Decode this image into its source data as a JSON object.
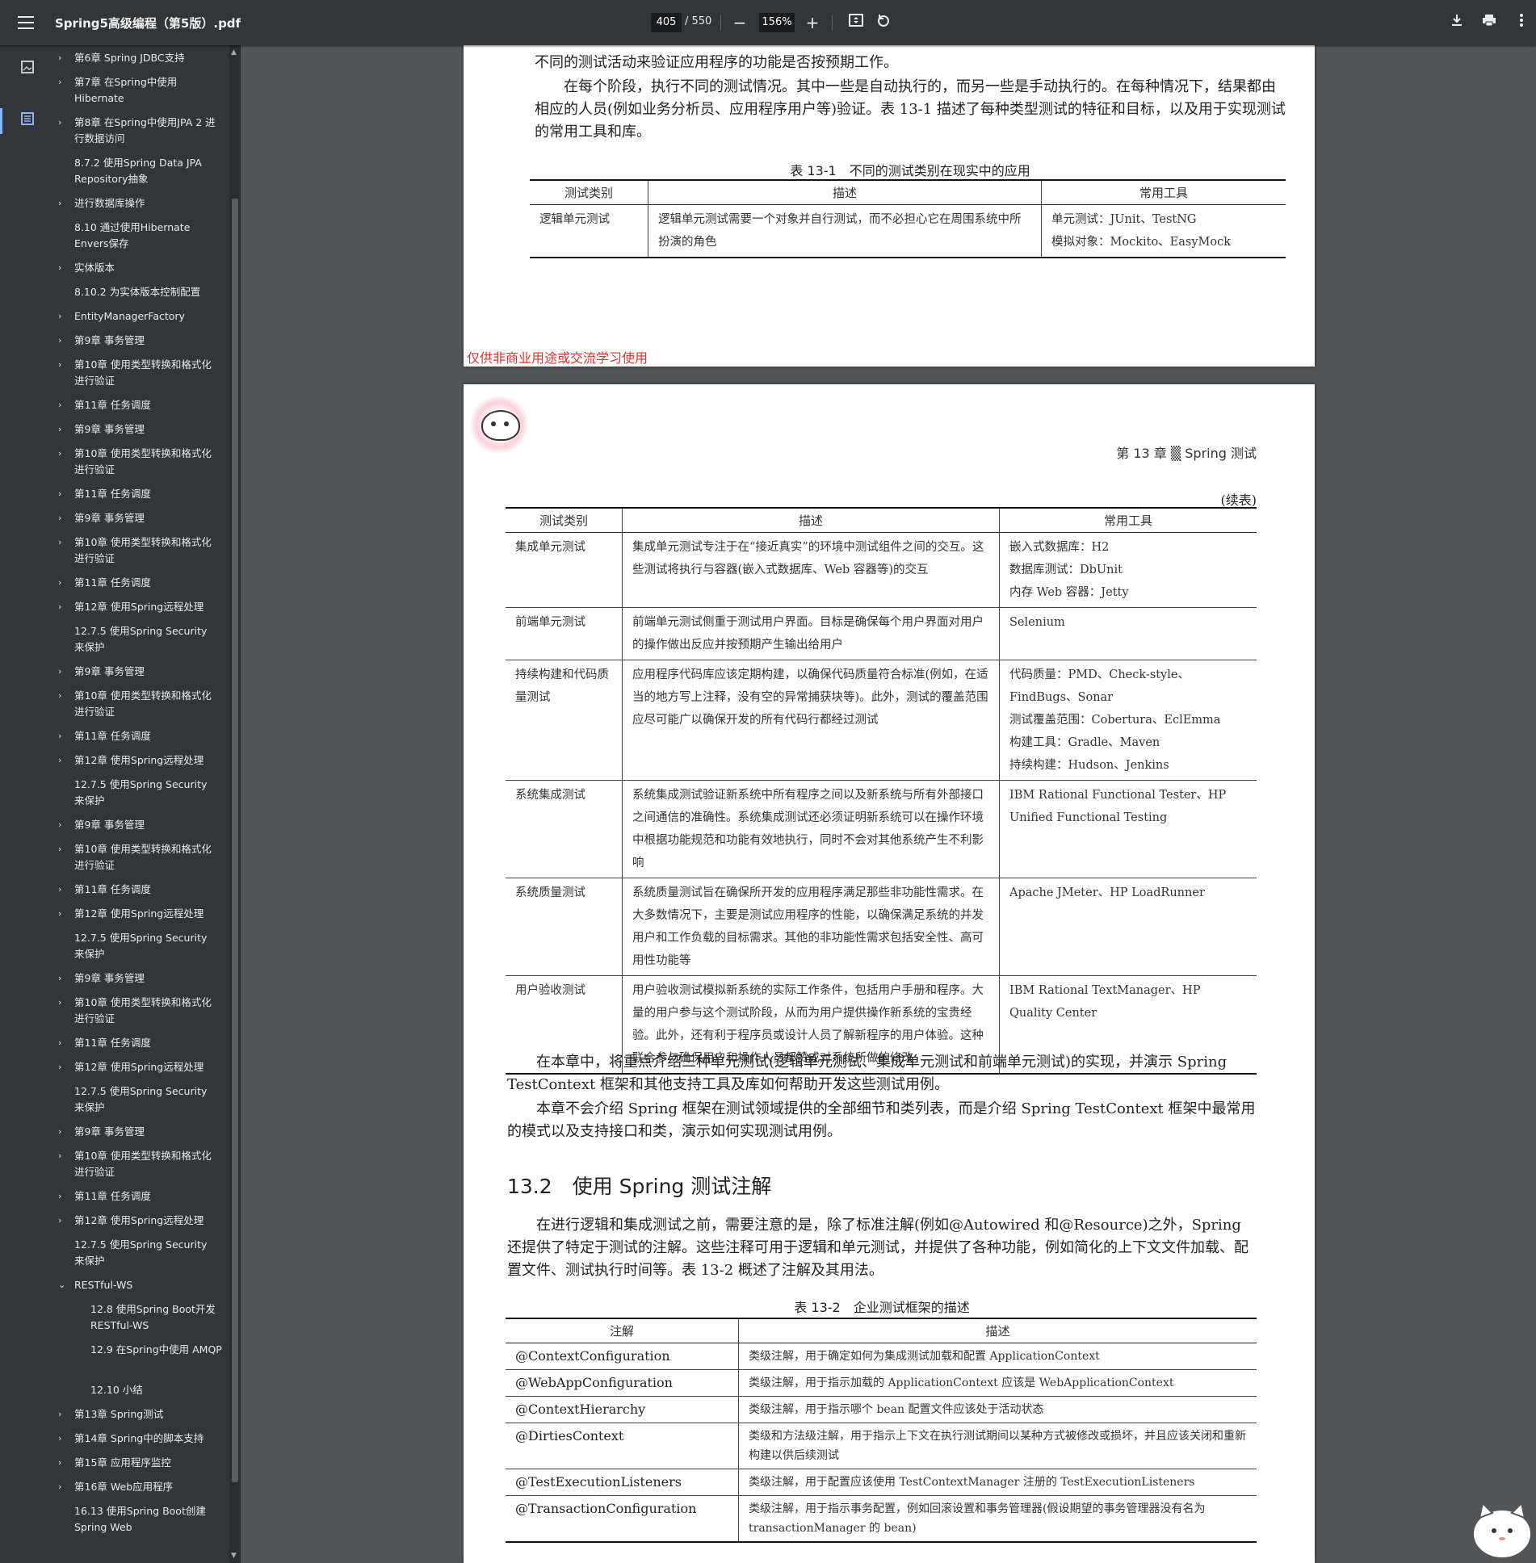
{
  "toolbar": {
    "title": "Spring5高级编程（第5版）.pdf",
    "page_current": "405",
    "page_total": "/ 550",
    "zoom": "156%",
    "zoom_out": "−",
    "zoom_in": "+"
  },
  "outline": [
    {
      "chev": "›",
      "label": "第6章 Spring JDBC支持"
    },
    {
      "chev": "›",
      "label": "第7章 在Spring中使用 Hibernate"
    },
    {
      "chev": "›",
      "label": "第8章 在Spring中使用JPA 2 进行数据访问"
    },
    {
      "chev": "",
      "label": "8.7.2 使用Spring Data JPA Repository抽象"
    },
    {
      "chev": "›",
      "label": "进行数据库操作"
    },
    {
      "chev": "",
      "label": "8.10 通过使用Hibernate Envers保存"
    },
    {
      "chev": "›",
      "label": "实体版本"
    },
    {
      "chev": "",
      "label": "8.10.2 为实体版本控制配置"
    },
    {
      "chev": "›",
      "label": "EntityManagerFactory"
    },
    {
      "chev": "›",
      "label": "第9章 事务管理"
    },
    {
      "chev": "›",
      "label": "第10章 使用类型转换和格式化进行验证"
    },
    {
      "chev": "›",
      "label": "第11章 任务调度"
    },
    {
      "chev": "›",
      "label": "第9章 事务管理"
    },
    {
      "chev": "›",
      "label": "第10章 使用类型转换和格式化进行验证"
    },
    {
      "chev": "›",
      "label": "第11章 任务调度"
    },
    {
      "chev": "›",
      "label": "第9章 事务管理"
    },
    {
      "chev": "›",
      "label": "第10章 使用类型转换和格式化进行验证"
    },
    {
      "chev": "›",
      "label": "第11章 任务调度"
    },
    {
      "chev": "›",
      "label": "第12章 使用Spring远程处理"
    },
    {
      "chev": "",
      "label": "12.7.5 使用Spring Security来保护"
    },
    {
      "chev": "›",
      "label": "第9章 事务管理"
    },
    {
      "chev": "›",
      "label": "第10章 使用类型转换和格式化进行验证"
    },
    {
      "chev": "›",
      "label": "第11章 任务调度"
    },
    {
      "chev": "›",
      "label": "第12章 使用Spring远程处理"
    },
    {
      "chev": "",
      "label": "12.7.5 使用Spring Security来保护"
    },
    {
      "chev": "›",
      "label": "第9章 事务管理"
    },
    {
      "chev": "›",
      "label": "第10章 使用类型转换和格式化进行验证"
    },
    {
      "chev": "›",
      "label": "第11章 任务调度"
    },
    {
      "chev": "›",
      "label": "第12章 使用Spring远程处理"
    },
    {
      "chev": "",
      "label": "12.7.5 使用Spring Security来保护"
    },
    {
      "chev": "›",
      "label": "第9章 事务管理"
    },
    {
      "chev": "›",
      "label": "第10章 使用类型转换和格式化进行验证"
    },
    {
      "chev": "›",
      "label": "第11章 任务调度"
    },
    {
      "chev": "›",
      "label": "第12章 使用Spring远程处理"
    },
    {
      "chev": "",
      "label": "12.7.5 使用Spring Security来保护"
    },
    {
      "chev": "›",
      "label": "第9章 事务管理"
    },
    {
      "chev": "›",
      "label": "第10章 使用类型转换和格式化进行验证"
    },
    {
      "chev": "›",
      "label": "第11章 任务调度"
    },
    {
      "chev": "›",
      "label": "第12章 使用Spring远程处理"
    },
    {
      "chev": "",
      "label": "12.7.5 使用Spring Security来保护"
    },
    {
      "chev": "⌄",
      "label": "RESTful-WS"
    },
    {
      "chev": "",
      "label": "12.8 使用Spring Boot开发 RESTful-WS"
    },
    {
      "chev": "",
      "label": "12.9 在Spring中使用 AMQP"
    },
    {
      "chev": "",
      "label": "12.10 小结"
    },
    {
      "chev": "›",
      "label": "第13章 Spring测试"
    },
    {
      "chev": "›",
      "label": "第14章 Spring中的脚本支持"
    },
    {
      "chev": "›",
      "label": "第15章 应用程序监控"
    },
    {
      "chev": "›",
      "label": "第16章 Web应用程序"
    },
    {
      "chev": "",
      "label": "16.13 使用Spring Boot创建 Spring Web"
    }
  ],
  "page1": {
    "top_line": "企业测试框架是指在整个应用程序生命周期中的测试活动。在不同的阶段，根据所定义的业务和技术要求，执行不同的测试活动来验证应用程序的功能是否按预期工作。",
    "top_line_visible": "不同的测试活动来验证应用程序的功能是否按预期工作。",
    "para": "在每个阶段，执行不同的测试情况。其中一些是自动执行的，而另一些是手动执行的。在每种情况下，结果都由相应的人员(例如业务分析员、应用程序用户等)验证。表 13-1 描述了每种类型测试的特征和目标，以及用于实现测试的常用工具和库。",
    "caption": "表 13-1　不同的测试类别在现实中的应用",
    "headers": [
      "测试类别",
      "描述",
      "常用工具"
    ],
    "rows": [
      [
        "逻辑单元测试",
        "逻辑单元测试需要一个对象并自行测试，而不必担心它在周围系统中所扮演的角色",
        "单元测试：JUnit、TestNG\n模拟对象：Mockito、EasyMock"
      ]
    ],
    "watermark": "仅供非商业用途或交流学习使用"
  },
  "page2": {
    "running_head": "第 13 章 ▒ Spring 测试",
    "continued": "(续表)",
    "headers": [
      "测试类别",
      "描述",
      "常用工具"
    ],
    "rows": [
      [
        "集成单元测试",
        "集成单元测试专注于在“接近真实”的环境中测试组件之间的交互。这些测试将执行与容器(嵌入式数据库、Web 容器等)的交互",
        "嵌入式数据库：H2\n数据库测试：DbUnit\n内存 Web 容器：Jetty"
      ],
      [
        "前端单元测试",
        "前端单元测试侧重于测试用户界面。目标是确保每个用户界面对用户的操作做出反应并按预期产生输出给用户",
        "Selenium"
      ],
      [
        "持续构建和代码质量测试",
        "应用程序代码库应该定期构建，以确保代码质量符合标准(例如，在适当的地方写上注释，没有空的异常捕获块等)。此外，测试的覆盖范围应尽可能广以确保开发的所有代码行都经过测试",
        "代码质量：PMD、Check-style、FindBugs、Sonar\n测试覆盖范围：Cobertura、EclEmma\n构建工具：Gradle、Maven\n持续构建：Hudson、Jenkins"
      ],
      [
        "系统集成测试",
        "系统集成测试验证新系统中所有程序之间以及新系统与所有外部接口之间通信的准确性。系统集成测试还必须证明新系统可以在操作环境中根据功能规范和功能有效地执行，同时不会对其他系统产生不利影响",
        "IBM Rational Functional Tester、HP Unified Functional Testing"
      ],
      [
        "系统质量测试",
        "系统质量测试旨在确保所开发的应用程序满足那些非功能性需求。在大多数情况下，主要是测试应用程序的性能，以确保满足系统的并发用户和工作负载的目标需求。其他的非功能性需求包括安全性、高可用性功能等",
        "Apache JMeter、HP LoadRunner"
      ],
      [
        "用户验收测试",
        "用户验收测试模拟新系统的实际工作条件，包括用户手册和程序。大量的用户参与这个测试阶段，从而为用户提供操作新系统的宝贵经验。此外，还有利于程序员或设计人员了解新程序的用户体验。这种联合参与确保用户和操作人员都赞成对系统所做的修改",
        "IBM Rational TextManager、HP Quality Center"
      ]
    ],
    "para1": "在本章中，将重点介绍三种单元测试(逻辑单元测试、集成单元测试和前端单元测试)的实现，并演示 Spring TestContext 框架和其他支持工具及库如何帮助开发这些测试用例。",
    "para2": "本章不会介绍 Spring 框架在测试领域提供的全部细节和类列表，而是介绍 Spring TestContext 框架中最常用的模式以及支持接口和类，演示如何实现测试用例。",
    "heading": "13.2　使用 Spring 测试注解",
    "para3": "在进行逻辑和集成测试之前，需要注意的是，除了标准注解(例如@Autowired 和@Resource)之外，Spring 还提供了特定于测试的注解。这些注释可用于逻辑和单元测试，并提供了各种功能，例如简化的上下文文件加载、配置文件、测试执行时间等。表 13-2 概述了注解及其用法。",
    "caption2": "表 13-2　企业测试框架的描述",
    "headers2": [
      "注解",
      "描述"
    ],
    "rows2": [
      [
        "@ContextConfiguration",
        "类级注解，用于确定如何为集成测试加载和配置 ApplicationContext"
      ],
      [
        "@WebAppConfiguration",
        "类级注解，用于指示加载的 ApplicationContext 应该是 WebApplicationContext"
      ],
      [
        "@ContextHierarchy",
        "类级注解，用于指示哪个 bean 配置文件应该处于活动状态"
      ],
      [
        "@DirtiesContext",
        "类级和方法级注解，用于指示上下文在执行测试期间以某种方式被修改或损坏，并且应该关闭和重新构建以供后续测试"
      ],
      [
        "@TestExecutionListeners",
        "类级注解，用于配置应该使用 TestContextManager 注册的 TestExecutionListeners"
      ],
      [
        "@TransactionConfiguration",
        "类级注解，用于指示事务配置，例如回滚设置和事务管理器(假设期望的事务管理器没有名为 transactionManager 的 bean)"
      ]
    ]
  }
}
